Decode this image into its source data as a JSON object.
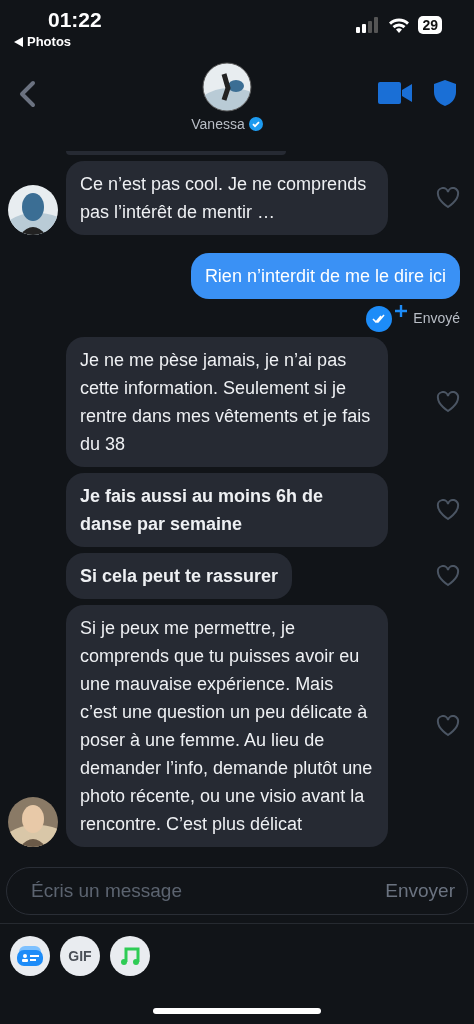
{
  "status_bar": {
    "time": "01:22",
    "back_label": "Photos",
    "battery": "29"
  },
  "header": {
    "name": "Vanessa",
    "verified": true
  },
  "messages": [
    {
      "kind": "incoming",
      "text": "Ce n’est pas cool. Je ne comprends pas l’intérêt de mentir …",
      "bold": false,
      "avatar": true,
      "liked": false
    },
    {
      "kind": "outgoing",
      "text": "Rien n’interdit de me le dire ici",
      "status": "Envoyé"
    },
    {
      "kind": "incoming",
      "text": "Je ne me pèse jamais, je n’ai pas cette information. Seulement si je rentre dans mes vêtements et je fais du 38",
      "bold": false,
      "avatar": false,
      "liked": false
    },
    {
      "kind": "incoming",
      "text": "Je fais aussi au moins 6h de danse par semaine",
      "bold": true,
      "avatar": false,
      "liked": false
    },
    {
      "kind": "incoming",
      "text": "Si cela peut te rassurer",
      "bold": true,
      "avatar": false,
      "liked": false
    },
    {
      "kind": "incoming",
      "text": "Si je peux me permettre, je comprends que tu puisses avoir eu une mauvaise expérience. Mais c’est une question un peu délicate à poser à une femme. Au lieu de demander l’info, demande plutôt une photo récente, ou une visio avant la rencontre. C’est plus délicat",
      "bold": false,
      "avatar": true,
      "liked": false
    }
  ],
  "composer": {
    "placeholder": "Écris un message",
    "send_label": "Envoyer"
  },
  "attachments": [
    {
      "kind": "card"
    },
    {
      "kind": "gif",
      "label": "GIF"
    },
    {
      "kind": "music"
    }
  ]
}
